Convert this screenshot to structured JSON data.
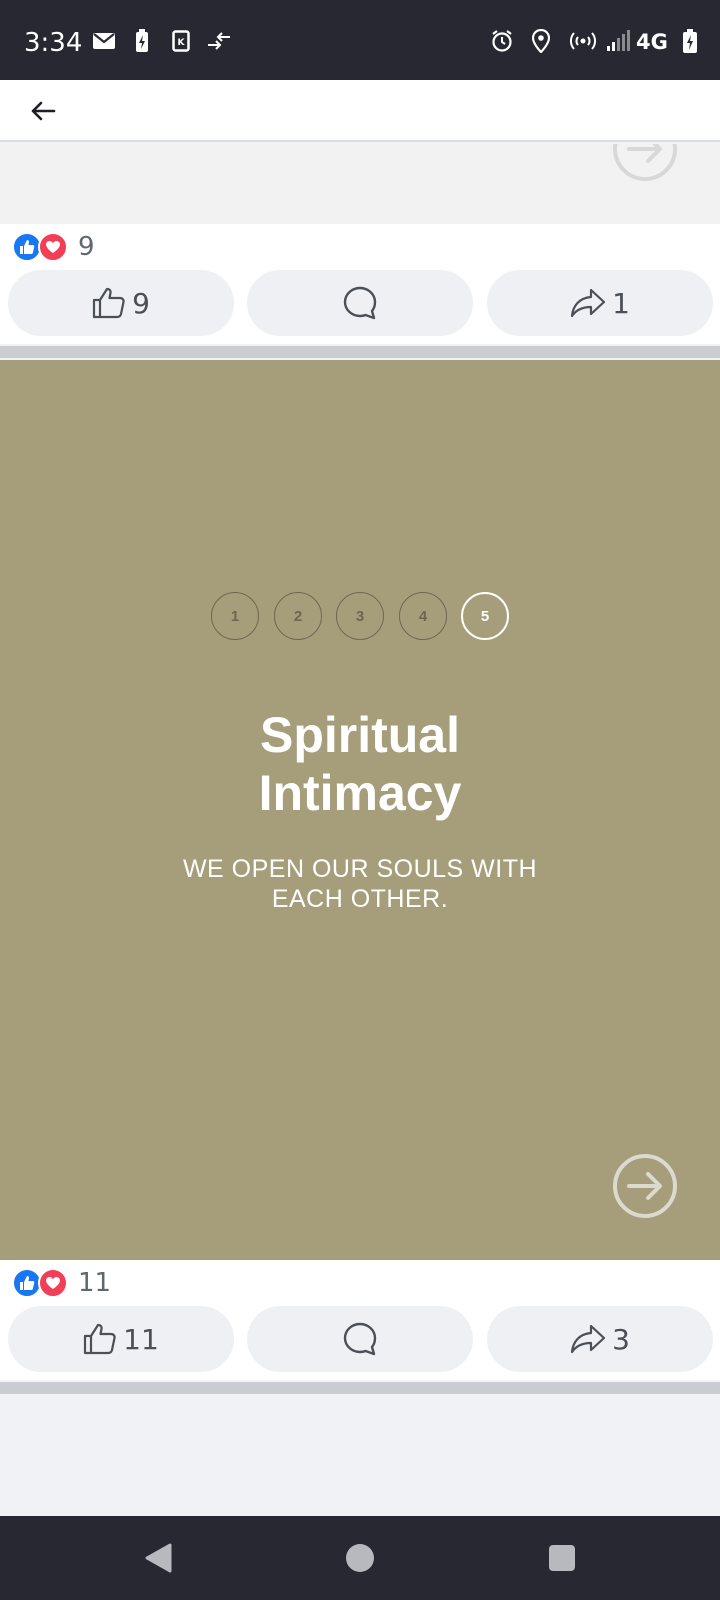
{
  "status_bar": {
    "time": "3:34",
    "network": "4G",
    "icons_left": [
      "mail-icon",
      "battery-saver-icon",
      "keyboard-icon",
      "data-transfer-icon"
    ],
    "icons_right": [
      "alarm-icon",
      "location-icon",
      "hotspot-icon",
      "signal-icon",
      "battery-icon"
    ]
  },
  "header": {
    "back_icon": "arrow-left-icon"
  },
  "post1": {
    "reaction_count": "9",
    "like_count": "9",
    "share_count": "1"
  },
  "post2": {
    "steps": [
      "1",
      "2",
      "3",
      "4",
      "5"
    ],
    "active_step": "5",
    "title_line1": "Spiritual",
    "title_line2": "Intimacy",
    "subtitle_line1": "WE OPEN OUR SOULS WITH",
    "subtitle_line2": "EACH OTHER.",
    "background_color": "#a69e7b",
    "reaction_count": "11",
    "like_count": "11",
    "share_count": "3"
  },
  "colors": {
    "like_blue": "#1877f2",
    "love_red": "#f33e58",
    "status_bar": "#282832"
  }
}
